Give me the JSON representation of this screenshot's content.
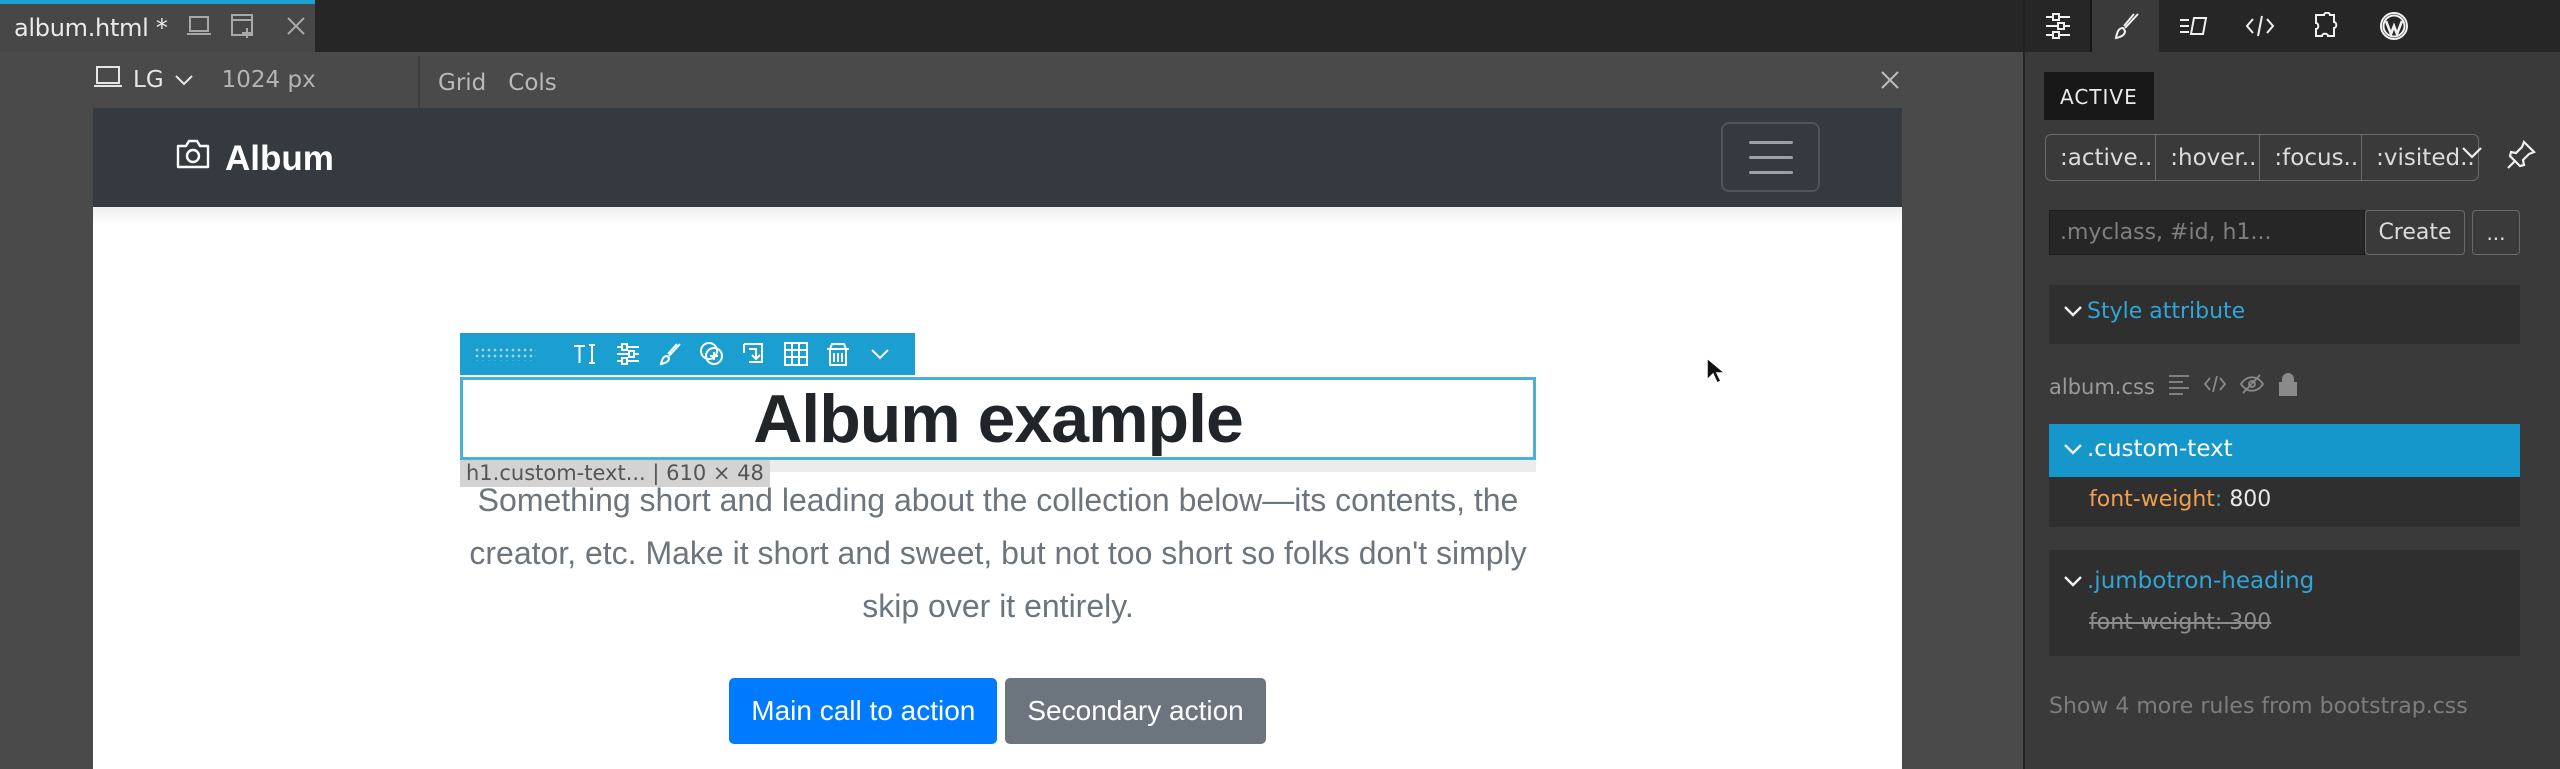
{
  "tabbar": {
    "active_tab": {
      "label": "album.html *",
      "accent": "#1ba1d2"
    }
  },
  "device_toolbar": {
    "device_label": "LG",
    "width_label": "1024 px",
    "grid_label": "Grid",
    "cols_label": "Cols"
  },
  "page": {
    "brand": "Album",
    "heading": "Album example",
    "lead": "Something short and leading about the collection below—its contents, the creator, etc. Make it short and sweet, but not too short so folks don't simply skip over it entirely.",
    "primary_button": "Main call to action",
    "secondary_button": "Secondary action",
    "colors": {
      "navbar": "#343a40",
      "primary": "#007bff",
      "secondary": "#6c757d"
    }
  },
  "selection": {
    "label": "h1.custom-text... | 610 × 48",
    "toolbar_icons": [
      "drag-grip-icon",
      "text-edit-icon",
      "settings-sliders-icon",
      "brush-icon",
      "add-circle-icon",
      "insert-icon",
      "table-icon",
      "trash-icon",
      "chevron-down-icon"
    ]
  },
  "right_panel": {
    "toolbar_icons": [
      "settings-sliders-icon",
      "brush-icon",
      "text-style-icon",
      "code-icon",
      "plugin-icon",
      "wordpress-icon"
    ],
    "active_label": "ACTIVE",
    "states": [
      ":active..",
      ":hover..",
      ":focus..",
      ":visited.."
    ],
    "selector_placeholder": ".myclass, #id, h1...",
    "create_label": "Create",
    "more_label": "...",
    "style_attribute_label": "Style attribute",
    "stylesheet_label": "album.css",
    "rules": [
      {
        "selector": ".custom-text",
        "property": "font-weight",
        "value": "800",
        "active": true,
        "overridden": false
      },
      {
        "selector": ".jumbotron-heading",
        "property": "font-weight",
        "value": "300",
        "active": false,
        "overridden": true
      }
    ],
    "show_more_label": "Show 4 more rules from bootstrap.css",
    "accent": "#1597cc"
  }
}
